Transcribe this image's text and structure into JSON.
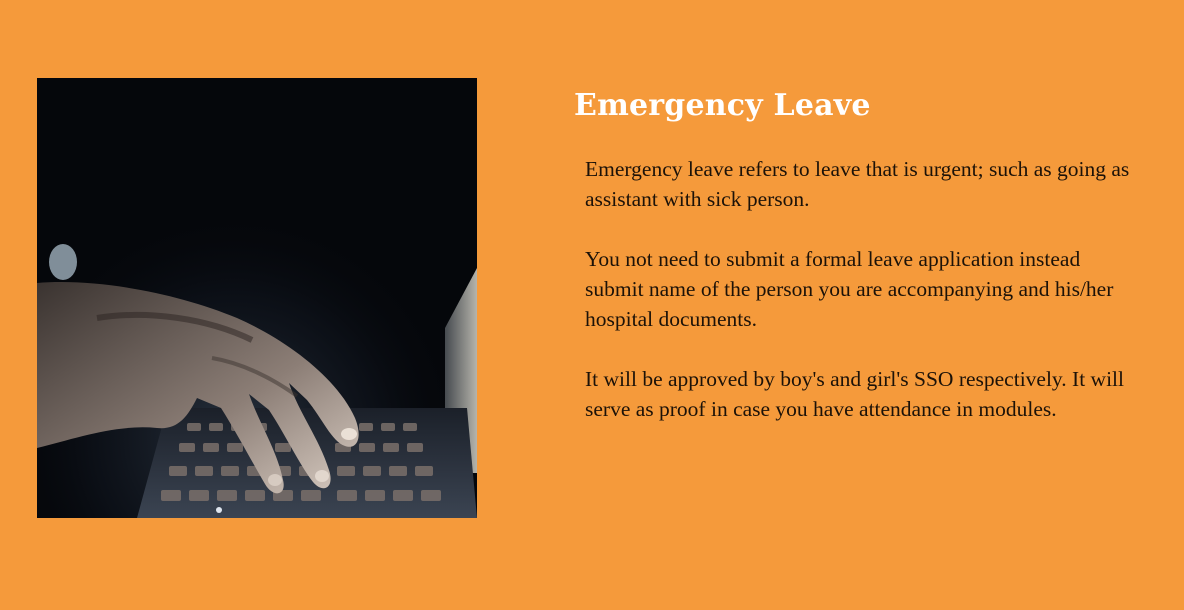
{
  "theme": {
    "background": "#f59a3b",
    "title_color": "#ffffff",
    "text_color": "#1c1208"
  },
  "photo": {
    "subject": "hand-typing-on-laptop-keyboard"
  },
  "heading": {
    "title": "Emergency Leave"
  },
  "paragraphs": [
    "Emergency leave refers to leave that is urgent; such as going as assistant with sick person.",
    "You not need to submit a formal leave application instead submit name of the person you are accompanying and his/her hospital documents.",
    "It will be approved by boy's and girl's SSO respectively. It will serve as proof in case you have attendance in modules."
  ]
}
